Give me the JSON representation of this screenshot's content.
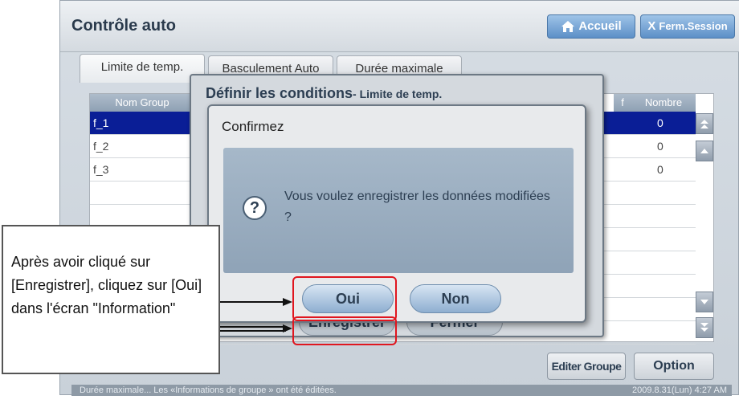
{
  "app": {
    "title": "Contrôle auto",
    "home_label": "Accueil",
    "logout_label": "Ferm.Session",
    "logout_mark": "X"
  },
  "tabs": [
    {
      "label": "Limite de temp."
    },
    {
      "label": "Basculement Auto"
    },
    {
      "label": "Durée maximale"
    }
  ],
  "grid": {
    "col_name": "Nom Group",
    "col_units": "Nombre d'unités",
    "col_units_prefix": "f",
    "rows": [
      {
        "name": "f_1",
        "units": "0"
      },
      {
        "name": "f_2",
        "units": "0"
      },
      {
        "name": "f_3",
        "units": "0"
      }
    ]
  },
  "actions": {
    "edit_group": "Editer Groupe",
    "option": "Option"
  },
  "status": {
    "message": "Durée maximale... Les «Informations de groupe » ont été éditées.",
    "datetime": "2009.8.31(Lun)  4:27 AM"
  },
  "conditions_dialog": {
    "title": "Définir les conditions",
    "subtitle": "- Limite de temp.",
    "save_label": "Enregistrer",
    "close_label": "Fermer"
  },
  "confirm_dialog": {
    "title": "Confirmez",
    "message": "Vous voulez enregistrer les données modifiées ?",
    "yes_label": "Oui",
    "no_label": "Non"
  },
  "callout": {
    "text": "Après avoir cliqué sur [Enregistrer], cliquez sur [Oui] dans l'écran \"Information\""
  },
  "colors": {
    "highlight": "#e0161f",
    "selected_row": "#0a1e96",
    "accent": "#5c8fc7"
  }
}
